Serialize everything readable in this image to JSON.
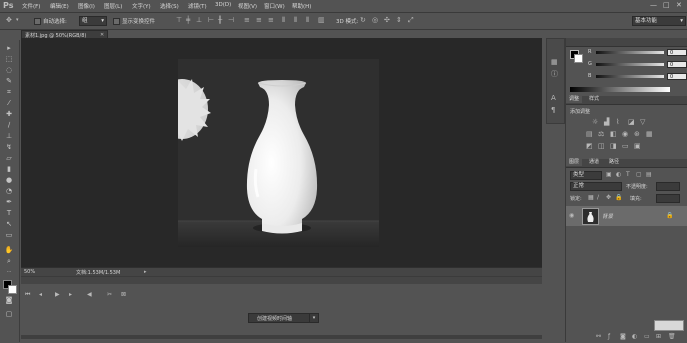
{
  "app": {
    "logo": "Ps"
  },
  "menu": [
    "文件(F)",
    "编辑(E)",
    "图像(I)",
    "图层(L)",
    "文字(Y)",
    "选择(S)",
    "滤镜(T)",
    "3D(D)",
    "视图(V)",
    "窗口(W)",
    "帮助(H)"
  ],
  "window_buttons": [
    "—",
    "□",
    "✕"
  ],
  "options": {
    "auto_select_label": "自动选择:",
    "auto_select_value": "组",
    "show_transform_label": "显示变换控件",
    "mode_3d_label": "3D 模式:",
    "workspace": "基本功能"
  },
  "document": {
    "tab_title": "素材1.jpg @ 50%(RGB/8)",
    "zoom": "50%",
    "doc_info": "文档:1.53M/1.53M"
  },
  "timeline": {
    "create_button_label": "创建视频时间轴"
  },
  "color_panel": {
    "channels": [
      "R",
      "G",
      "B"
    ],
    "values": [
      "0",
      "0",
      "0"
    ]
  },
  "adjustments_panel": {
    "tabs": [
      "调整",
      "样式"
    ],
    "heading": "添加调整"
  },
  "layers_panel": {
    "tabs": [
      "图层",
      "通道",
      "路径"
    ],
    "kind_label": "类型",
    "blend_mode": "正常",
    "opacity_label": "不透明度:",
    "lock_label": "锁定:",
    "fill_label": "填充:",
    "layer_name": "背景"
  },
  "colors": {
    "ui_bg": "#535353",
    "canvas_bg": "#282828",
    "image_bg": "#2e2e2e",
    "vase": "#f2f2f2"
  }
}
